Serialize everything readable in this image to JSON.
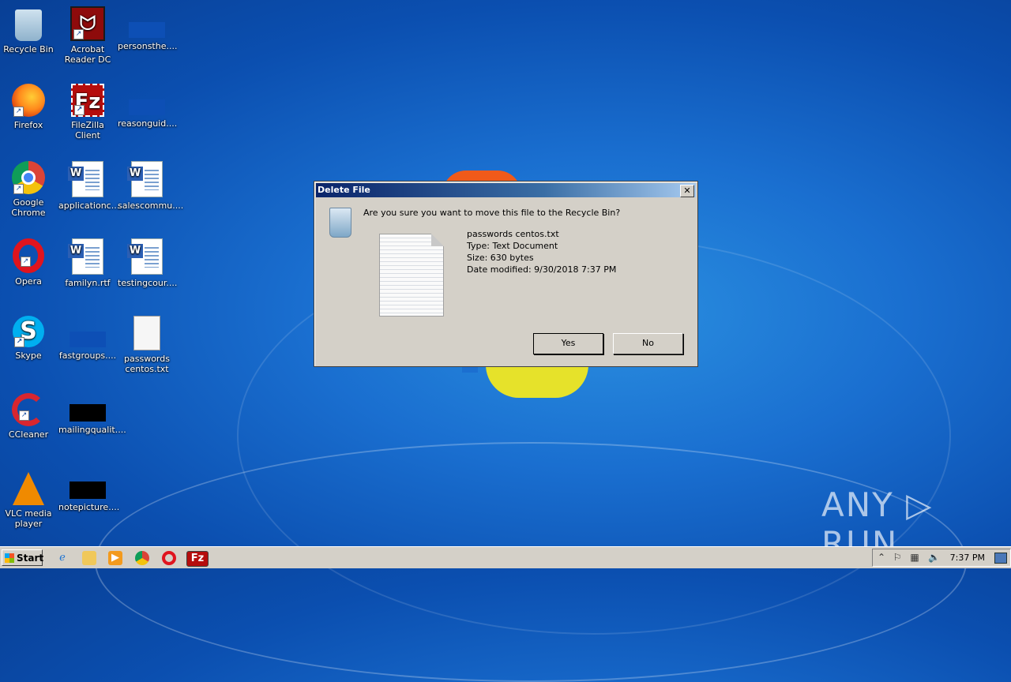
{
  "desktop": {
    "icons": [
      {
        "label": "Recycle Bin",
        "icon": "recycle-bin-icon"
      },
      {
        "label": "Acrobat Reader DC",
        "icon": "acrobat-icon"
      },
      {
        "label": "personsthe....",
        "icon": "blank-file-icon"
      },
      {
        "label": "Firefox",
        "icon": "firefox-icon"
      },
      {
        "label": "FileZilla Client",
        "icon": "filezilla-icon"
      },
      {
        "label": "reasonguid....",
        "icon": "blank-file-icon"
      },
      {
        "label": "Google Chrome",
        "icon": "chrome-icon"
      },
      {
        "label": "applicationc....",
        "icon": "word-document-icon"
      },
      {
        "label": "salescommu....",
        "icon": "word-document-icon"
      },
      {
        "label": "Opera",
        "icon": "opera-icon"
      },
      {
        "label": "familyn.rtf",
        "icon": "word-document-icon"
      },
      {
        "label": "testingcour....",
        "icon": "word-document-icon"
      },
      {
        "label": "Skype",
        "icon": "skype-icon"
      },
      {
        "label": "fastgroups....",
        "icon": "blank-file-icon"
      },
      {
        "label": "passwords centos.txt",
        "icon": "text-file-icon"
      },
      {
        "label": "CCleaner",
        "icon": "ccleaner-icon"
      },
      {
        "label": "mailingqualit....",
        "icon": "black-file-icon"
      },
      {
        "label": "VLC media player",
        "icon": "vlc-icon"
      },
      {
        "label": "notepicture....",
        "icon": "black-file-icon"
      }
    ]
  },
  "dialog": {
    "title": "Delete File",
    "close_label": "✕",
    "question": "Are you sure you want to move this file to the Recycle Bin?",
    "file": {
      "name": "passwords centos.txt",
      "type": "Type: Text Document",
      "size": "Size: 630 bytes",
      "modified": "Date modified: 9/30/2018 7:37 PM"
    },
    "yes_label": "Yes",
    "no_label": "No"
  },
  "watermark": "ANY ▷ RUN",
  "taskbar": {
    "start_label": "Start",
    "clock": "7:37 PM",
    "pinned": [
      "internet-explorer-icon",
      "explorer-icon",
      "media-player-icon",
      "chrome-icon",
      "opera-icon",
      "filezilla-icon"
    ]
  }
}
